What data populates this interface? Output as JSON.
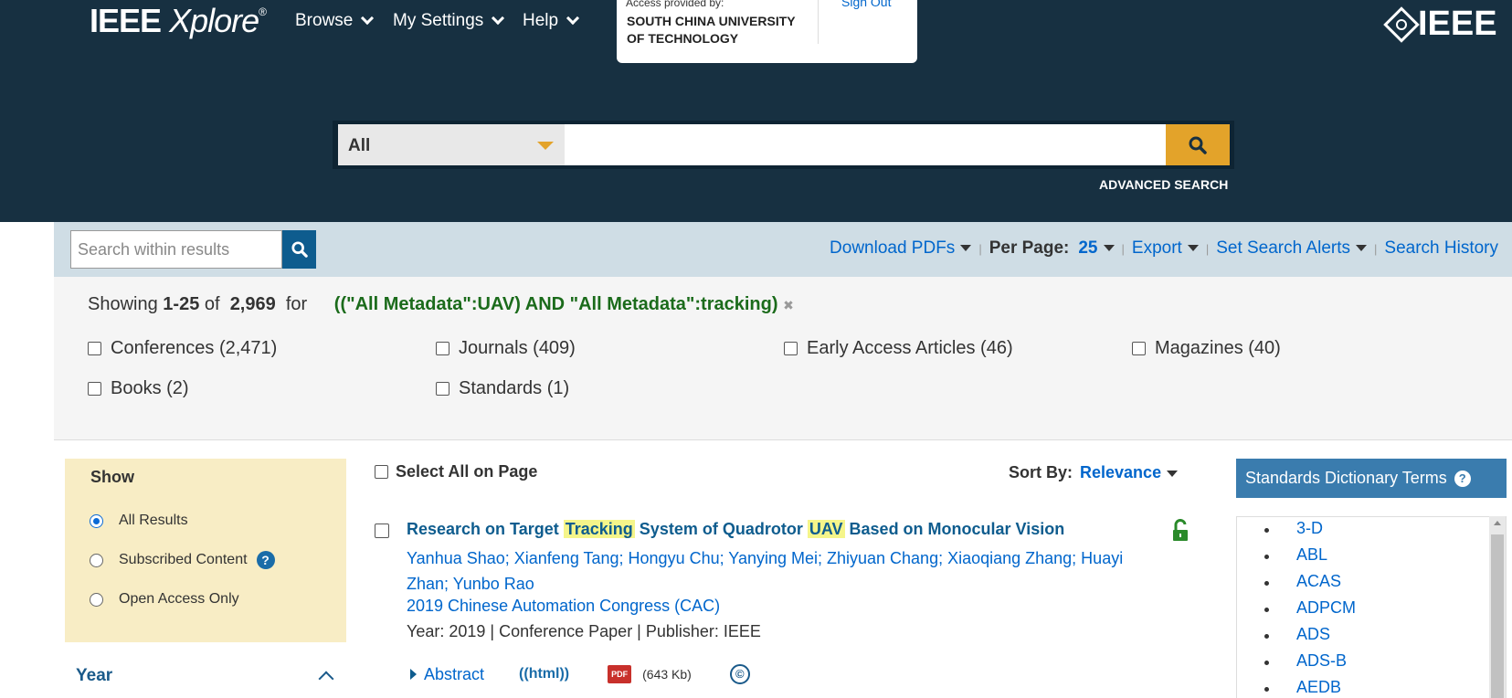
{
  "header": {
    "logo_main": "IEEE",
    "logo_italic": "Xplore",
    "logo_reg": "®",
    "nav": [
      "Browse",
      "My Settings",
      "Help"
    ],
    "access_label": "Access provided by:",
    "institution": "SOUTH CHINA UNIVERSITY OF TECHNOLOGY",
    "sign_out": "Sign Out",
    "ieee_logo": "IEEE"
  },
  "search": {
    "scope": "All",
    "query": "",
    "advanced": "ADVANCED SEARCH"
  },
  "toolbar": {
    "within_placeholder": "Search within results",
    "download": "Download PDFs",
    "per_page_label": "Per Page:",
    "per_page_value": "25",
    "export": "Export",
    "alerts": "Set Search Alerts",
    "history": "Search History"
  },
  "summary": {
    "prefix": "Showing",
    "range": "1-25",
    "of": "of",
    "total": "2,969",
    "for": "for",
    "query": "((\"All Metadata\":UAV) AND \"All Metadata\":tracking)",
    "clear": "✖"
  },
  "filters": [
    "Conferences (2,471)",
    "Journals (409)",
    "Early Access Articles (46)",
    "Magazines (40)",
    "Books (2)",
    "Standards (1)"
  ],
  "show_panel": {
    "title": "Show",
    "options": [
      "All Results",
      "Subscribed Content",
      "Open Access Only"
    ],
    "selected": "All Results",
    "help": "?"
  },
  "year_label": "Year",
  "results_header": {
    "select_all": "Select All on Page",
    "sort_label": "Sort By:",
    "sort_value": "Relevance"
  },
  "result": {
    "title_a": "Research on Target",
    "title_hl1": "Tracking",
    "title_b": "System of Quadrotor",
    "title_hl2": "UAV",
    "title_c": "Based on Monocular Vision",
    "authors": "Yanhua Shao; Xianfeng Tang; Hongyu Chu; Yanying Mei; Zhiyuan Chang; Xiaoqiang Zhang; Huayi Zhan; Yunbo Rao",
    "venue": "2019 Chinese Automation Congress (CAC)",
    "meta": "Year: 2019  |  Conference Paper  | Publisher:  IEEE",
    "abstract": "Abstract",
    "html": "((html))",
    "pdf_icon": "PDF",
    "pdf_size": "(643 Kb)",
    "copyright": "©"
  },
  "standards": {
    "title": "Standards Dictionary Terms",
    "help": "?",
    "terms": [
      "3-D",
      "ABL",
      "ACAS",
      "ADPCM",
      "ADS",
      "ADS-B",
      "AEDB"
    ]
  },
  "colors": {
    "header_bg": "#173041",
    "accent": "#e3a32a",
    "link": "#0066cc",
    "query_green": "#1b6b1b",
    "show_bg": "#f8edc5",
    "sdt_bg": "#3a7cae"
  }
}
